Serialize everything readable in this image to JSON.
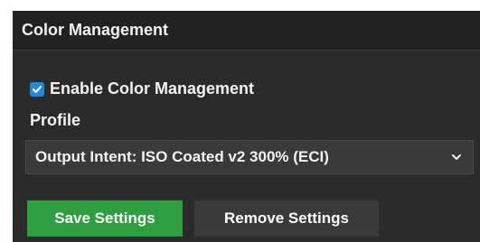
{
  "panel": {
    "title": "Color Management"
  },
  "enable_color_management": {
    "label": "Enable Color Management",
    "checked": true
  },
  "profile": {
    "label": "Profile",
    "selected": "Output Intent: ISO Coated v2 300% (ECI)"
  },
  "buttons": {
    "save": "Save Settings",
    "remove": "Remove Settings"
  },
  "icons": {
    "checkbox": "checkmark-icon",
    "select": "chevron-down-icon"
  },
  "colors": {
    "panel_bg": "#2b2b2b",
    "header_bg": "#222222",
    "checkbox_accent": "#1e88e5",
    "save_button": "#2e9e41",
    "remove_button": "#3a3a3a",
    "text": "#f2f2f2"
  }
}
